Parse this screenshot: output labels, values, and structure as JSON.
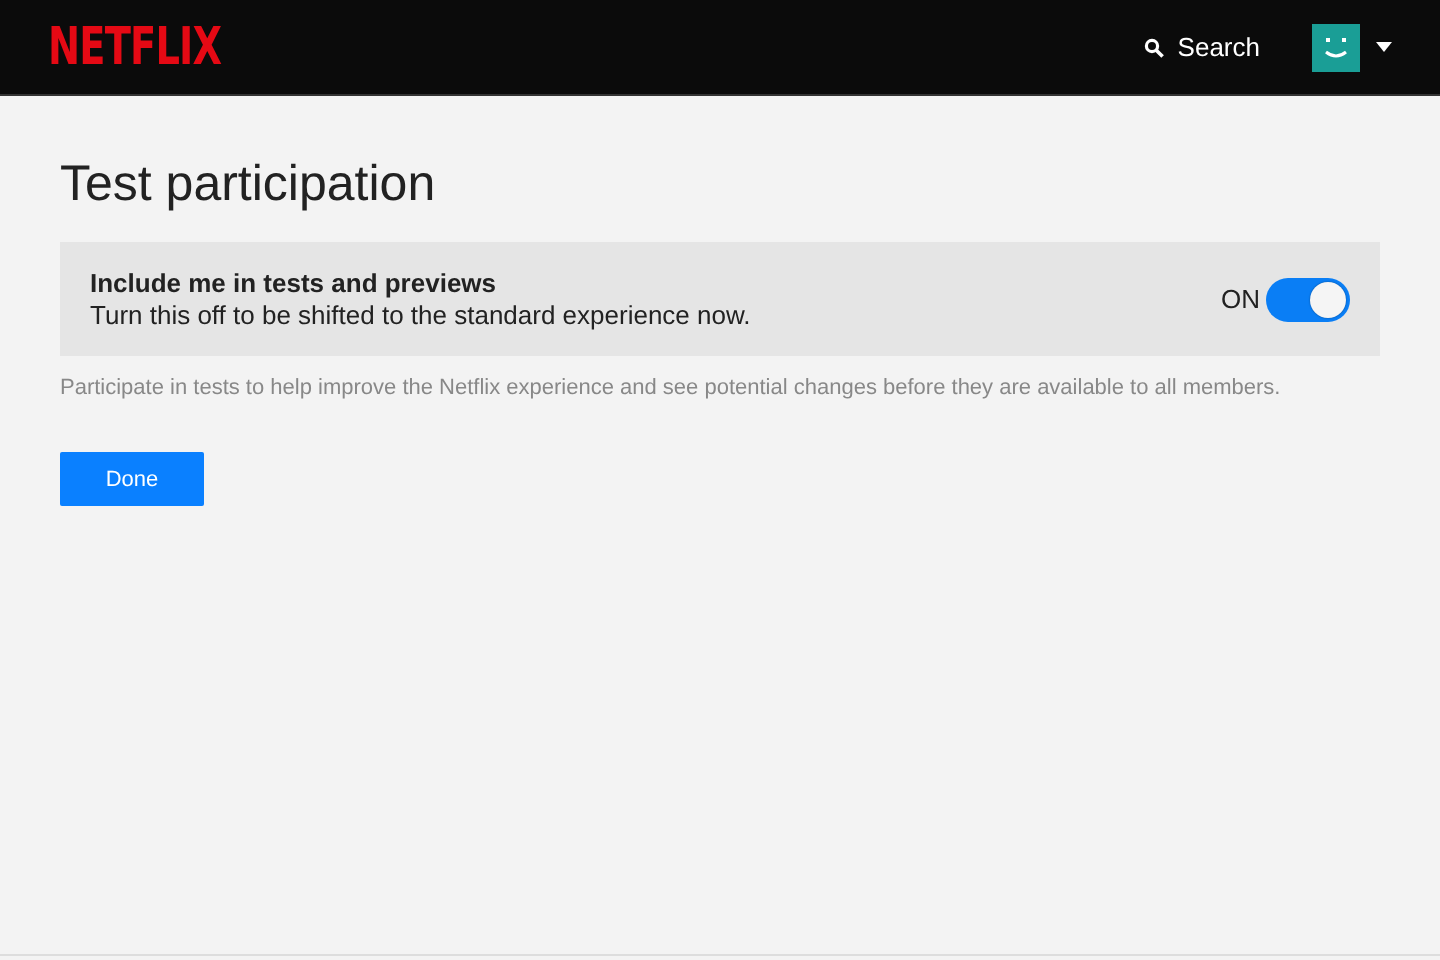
{
  "header": {
    "logo": "NETFLIX",
    "search": "Search"
  },
  "page": {
    "title": "Test participation",
    "setting": {
      "title": "Include me in tests and previews",
      "subtitle": "Turn this off to be shifted to the standard experience now.",
      "state_label": "ON",
      "on": true
    },
    "description": "Participate in tests to help improve the Netflix experience and see potential changes before they are available to all members.",
    "buttons": [
      "Done"
    ]
  }
}
